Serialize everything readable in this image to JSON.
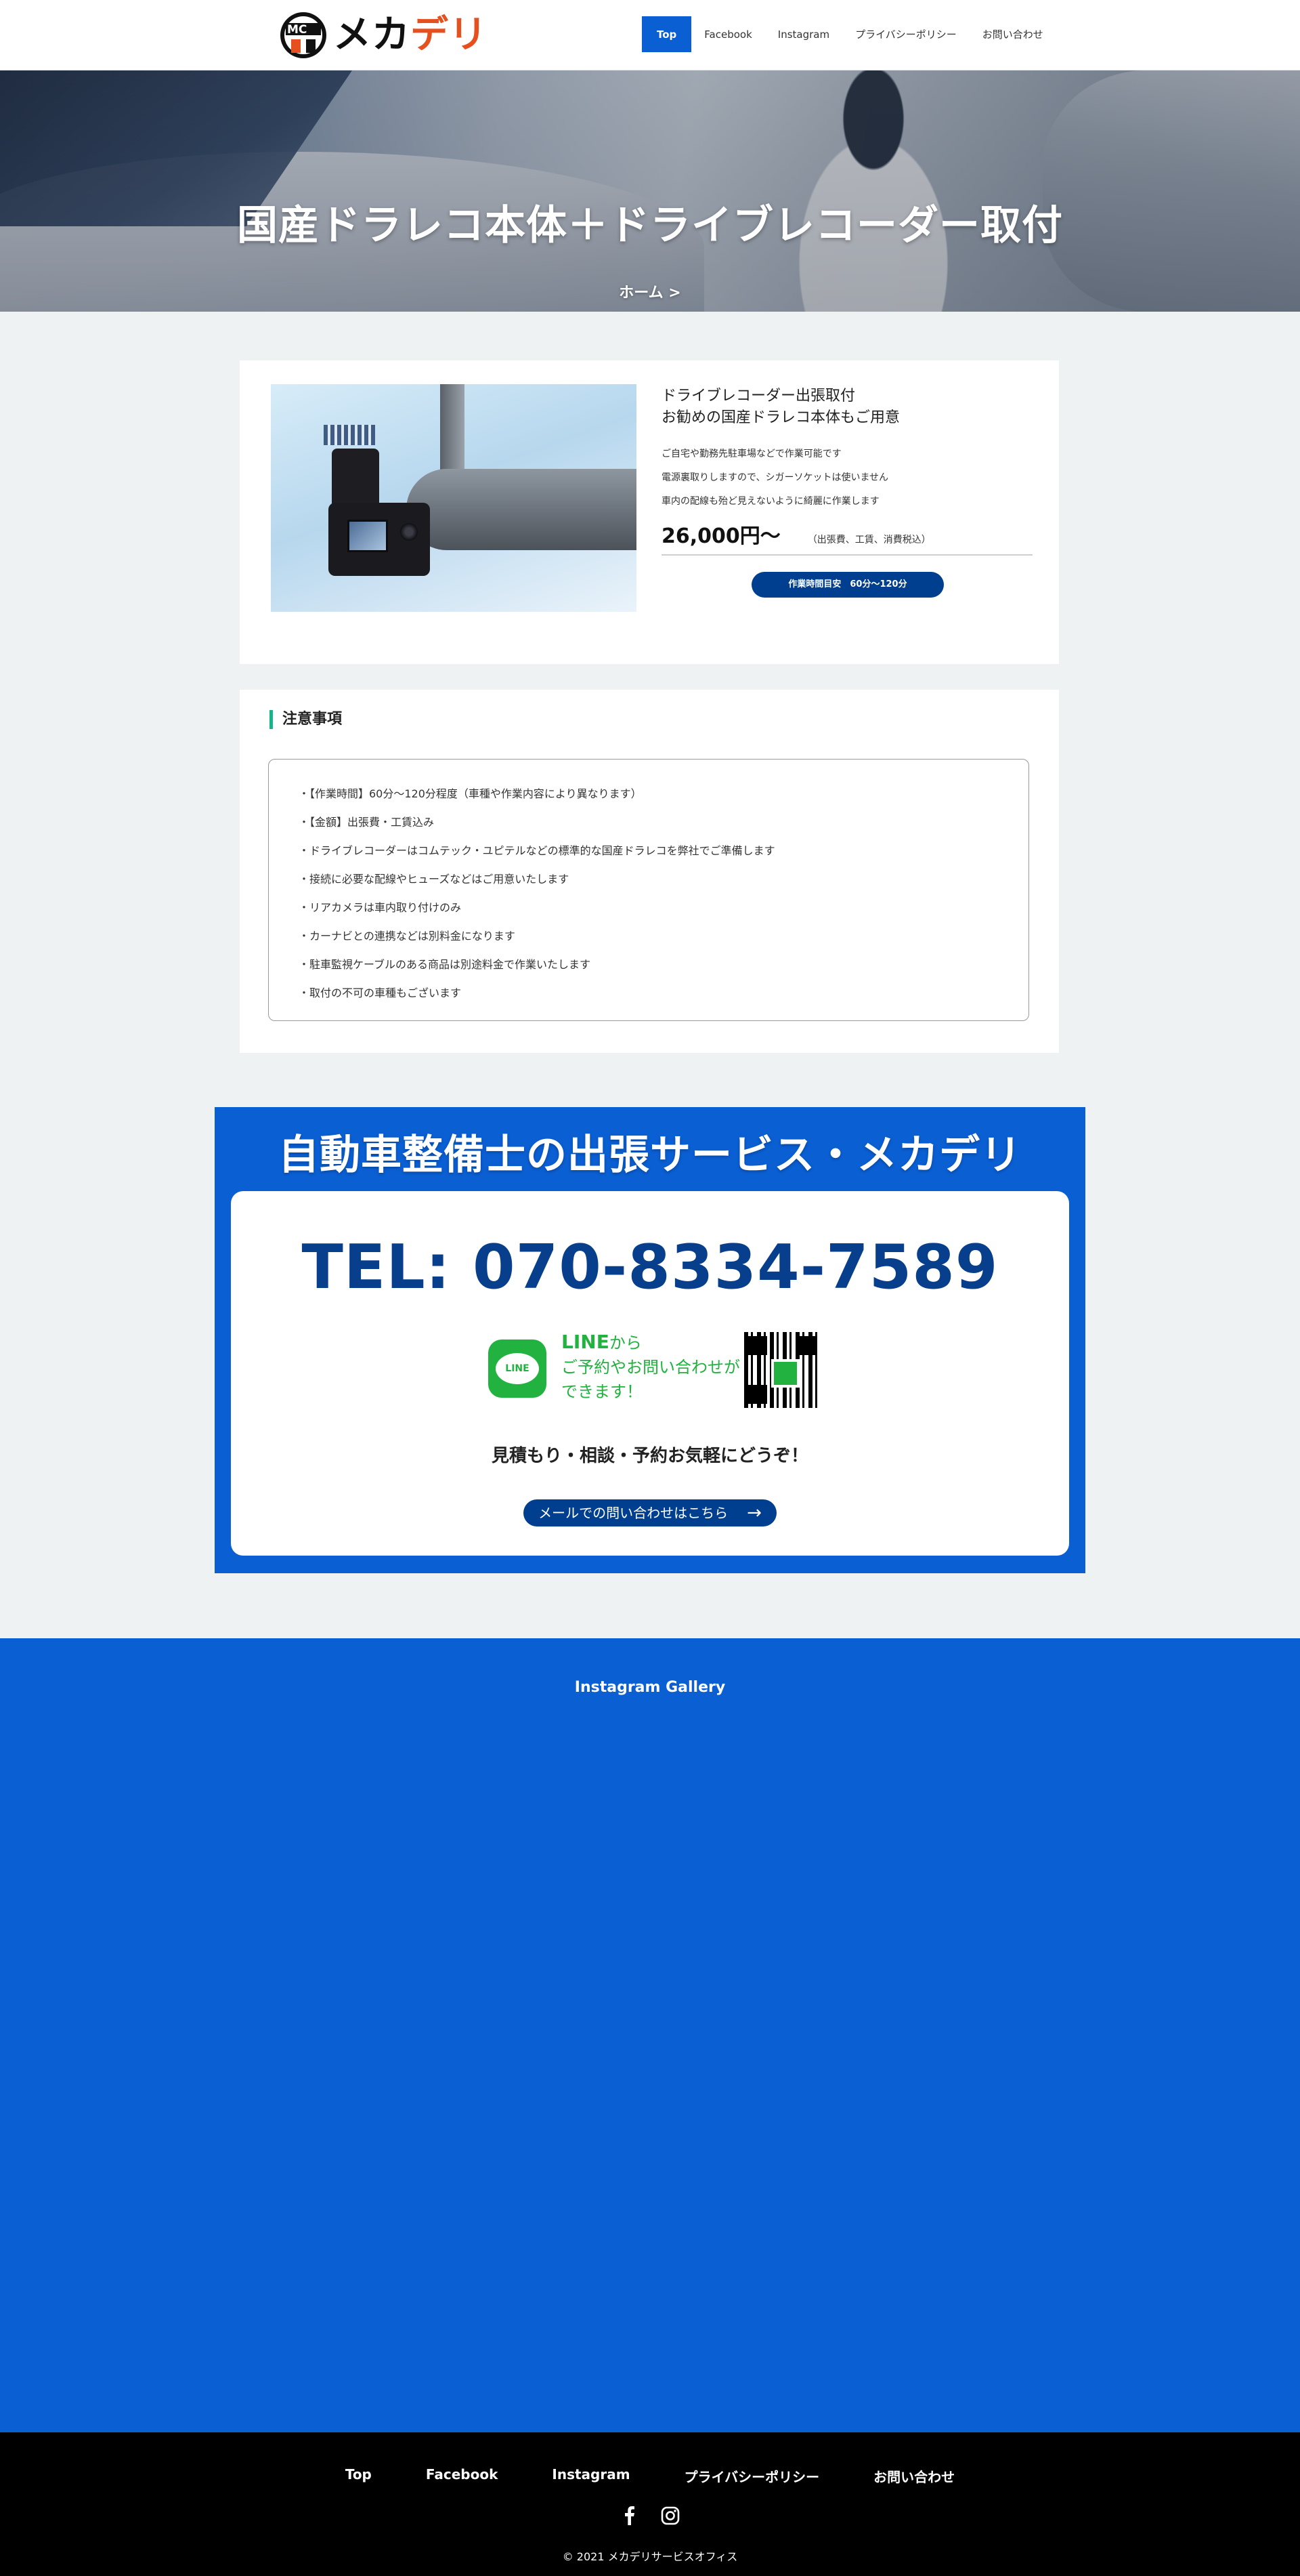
{
  "header": {
    "logo_text_main": "メカ",
    "logo_text_accent": "デリ",
    "nav": [
      {
        "label": "Top",
        "active": true
      },
      {
        "label": "Facebook"
      },
      {
        "label": "Instagram"
      },
      {
        "label": "プライバシーポリシー"
      },
      {
        "label": "お問い合わせ"
      }
    ]
  },
  "hero": {
    "title": "国産ドラレコ本体＋ドライブレコーダー取付",
    "breadcrumb": "ホーム >"
  },
  "product": {
    "heading_line1": "ドライブレコーダー出張取付",
    "heading_line2": "お勧めの国産ドラレコ本体もご用意",
    "desc": [
      "ご自宅や勤務先駐車場などで作業可能です",
      "電源裏取りしますので、シガーソケットは使いません",
      "車内の配線も殆ど見えないように綺麗に作業します"
    ],
    "price": "26,000円〜",
    "price_note": "（出張費、工賃、消費税込）",
    "time_badge": "作業時間目安　60分〜120分"
  },
  "notes": {
    "title": "注意事項",
    "items": [
      "・【作業時間】60分〜120分程度（車種や作業内容により異なります）",
      "・【金額】出張費・工賃込み",
      "・ドライブレコーダーはコムテック・ユピテルなどの標準的な国産ドラレコを弊社でご準備します",
      "・接続に必要な配線やヒューズなどはご用意いたします",
      "・リアカメラは車内取り付けのみ",
      "・カーナビとの連携などは別料金になります",
      "・駐車監視ケーブルのある商品は別途料金で作業いたします",
      "・取付の不可の車種もございます"
    ]
  },
  "contact": {
    "title": "自動車整備士の出張サービス・メカデリ",
    "tel": "TEL: 070-8334-7589",
    "line_icon_label": "LINE",
    "line_strong": "LINE",
    "line_from": "から",
    "line_text_2": "ご予約やお問い合わせが",
    "line_text_3": "できます！",
    "consult": "見積もり・相談・予約お気軽にどうぞ！",
    "mail_button": "メールでの問い合わせはこちら",
    "arrow": "→"
  },
  "gallery": {
    "title": "Instagram Gallery"
  },
  "footer": {
    "nav": [
      "Top",
      "Facebook",
      "Instagram",
      "プライバシーポリシー",
      "お問い合わせ"
    ],
    "copyright": "© 2021 メカデリサービスオフィス"
  },
  "colors": {
    "primary_blue": "#0a5fd3",
    "dark_blue": "#003f8f",
    "logo_accent": "#e5501e",
    "line_green": "#21b23f",
    "notes_accent": "#17b38a"
  },
  "icons": {
    "logo": "mc-logo-mark",
    "facebook": "facebook-icon",
    "instagram": "instagram-icon",
    "arrow": "arrow-right-icon",
    "line": "line-icon",
    "qr": "qr-code"
  }
}
